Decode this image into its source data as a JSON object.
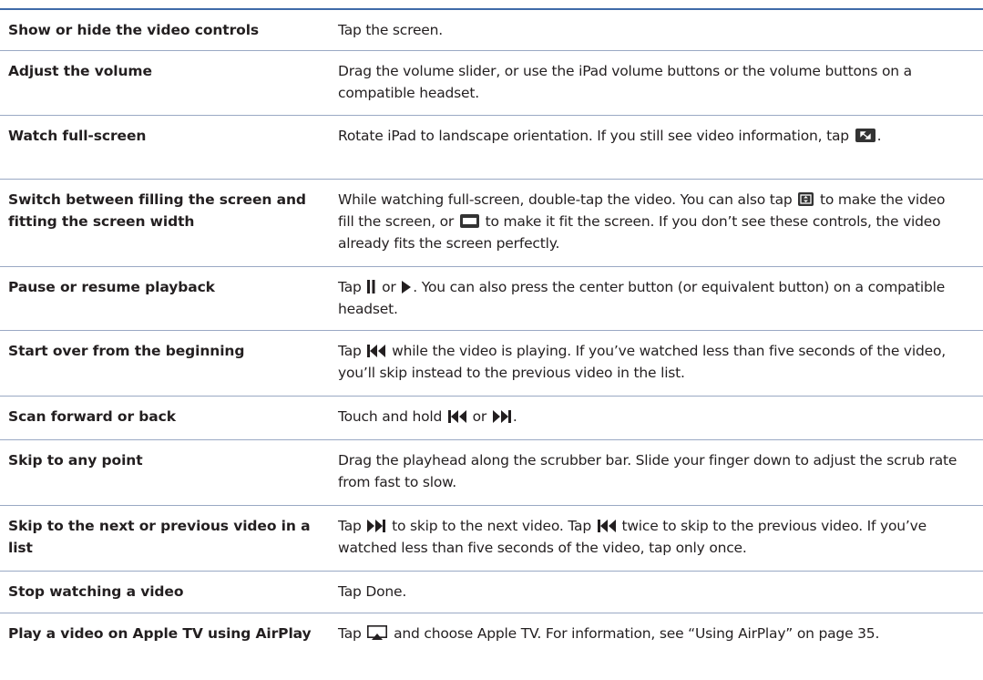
{
  "rows": [
    {
      "action": "Show or hide the video controls",
      "desc": [
        "Tap the screen."
      ]
    },
    {
      "action": "Adjust the volume",
      "desc": [
        "Drag the volume slider, or use the iPad volume buttons or the volume buttons on a compatible headset."
      ]
    },
    {
      "action": "Watch full-screen",
      "desc": [
        "Rotate iPad to landscape orientation. If you still see video information, tap ",
        "."
      ],
      "icons": [
        "fullscreen-icon"
      ]
    },
    {
      "action": "Switch between filling the screen and fitting the screen width",
      "desc": [
        "While watching full-screen, double-tap the video. You can also tap ",
        " to make the video fill the screen, or ",
        " to make it fit the screen. If you don’t see these controls, the video already fits the screen perfectly."
      ],
      "icons": [
        "fill-screen-icon",
        "fit-screen-icon"
      ]
    },
    {
      "action": "Pause or resume playback",
      "desc": [
        "Tap ",
        " or ",
        ". You can also press the center button (or equivalent button) on a compatible headset."
      ],
      "icons": [
        "pause-icon",
        "play-icon"
      ]
    },
    {
      "action": "Start over from the beginning",
      "desc": [
        "Tap ",
        " while the video is playing. If you’ve watched less than five seconds of the video, you’ll skip instead to the previous video in the list."
      ],
      "icons": [
        "previous-icon"
      ]
    },
    {
      "action": "Scan forward or back",
      "desc": [
        "Touch and hold ",
        " or ",
        "."
      ],
      "icons": [
        "previous-icon",
        "next-icon"
      ]
    },
    {
      "action": "Skip to any point",
      "desc": [
        "Drag the playhead along the scrubber bar. Slide your finger down to adjust the scrub rate from fast to slow."
      ]
    },
    {
      "action": "Skip to the next or previous video in a list",
      "desc": [
        "Tap ",
        " to skip to the next video. Tap ",
        " twice to skip to the previous video. If you’ve watched less than five seconds of the video, tap only once."
      ],
      "icons": [
        "next-icon",
        "previous-icon"
      ]
    },
    {
      "action": "Stop watching a video",
      "desc": [
        "Tap Done."
      ]
    },
    {
      "action": "Play a video on Apple TV using AirPlay",
      "desc": [
        "Tap ",
        " and choose Apple TV. For information, see “Using AirPlay” on page 35."
      ],
      "icons": [
        "airplay-icon"
      ]
    }
  ],
  "colors": {
    "rule_top": "#3f6ba8",
    "rule": "#9aa9c4",
    "text": "#231f20"
  }
}
